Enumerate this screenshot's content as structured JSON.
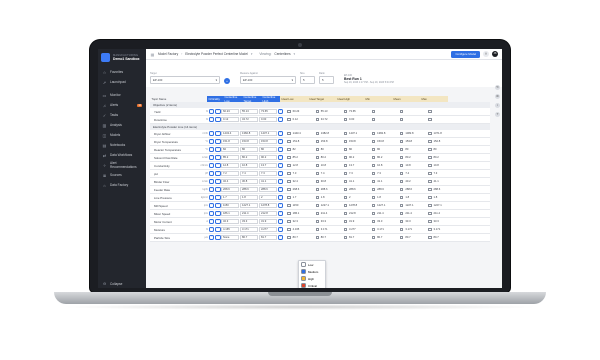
{
  "sidebar": {
    "org": "MANUFACTURING",
    "workspace": "Demo1 Sandbox",
    "items": [
      {
        "label": "Favorites",
        "icon": "star-icon"
      },
      {
        "label": "Launchpad",
        "icon": "rocket-icon"
      },
      {
        "label": "Monitor",
        "icon": "monitor-icon"
      },
      {
        "label": "Alerts",
        "icon": "bell-icon",
        "badge": "12"
      },
      {
        "label": "Tasks",
        "icon": "check-icon"
      },
      {
        "label": "Analysis",
        "icon": "chart-icon"
      },
      {
        "label": "Models",
        "icon": "cube-icon"
      },
      {
        "label": "Notebooks",
        "icon": "book-icon"
      },
      {
        "label": "Data Workflows",
        "icon": "flow-icon"
      },
      {
        "label": "Alert Recommendations",
        "icon": "lightbulb-icon"
      },
      {
        "label": "Sources",
        "icon": "database-icon"
      },
      {
        "label": "Data Factory",
        "icon": "factory-icon"
      }
    ],
    "collapse_label": "Collapse"
  },
  "topbar": {
    "breadcrumb": [
      "Model Factory",
      "Electrolyte Powder Perfect Centerline Model"
    ],
    "viewing_label": "Viewing:",
    "view_value": "Centerlines",
    "config_button": "Configure Model",
    "avatar": "JS"
  },
  "controls": {
    "target_label": "Target",
    "target_value": "EP-100",
    "measure_label": "Measure Against",
    "measure_value": "EP-100",
    "size_label": "Size",
    "size_value": "5",
    "rank_label": "Rank",
    "rank_value": "5",
    "batch_label": "EP-100",
    "batch_title": "Best Run 1",
    "batch_date": "Sep 19, 2023 1:17 PM - Sep 19, 2023 5:04 PM"
  },
  "table": {
    "col_topic": "Topic Name",
    "col_criticality": "Criticality",
    "col_low": "Centerline Low",
    "col_target": "Centerline Target",
    "col_high": "Centerline High",
    "col_ideal_low": "Ideal Low",
    "col_ideal_target": "Ideal Target",
    "col_ideal_high": "Ideal High",
    "col_min": "Min",
    "col_mean": "Mean",
    "col_max": "Max",
    "objective_section": "Objective (2 items)",
    "parameter_section": "Electrolyte Powder Line (14 items)",
    "objective_rows": [
      {
        "name": "Yield",
        "unit": "%",
        "low": "60.23",
        "target": "55.13",
        "high": "73.65",
        "ideal": "60.23",
        "mid": "55.13",
        "hi": "73.65",
        "min": "",
        "mean": "",
        "max": ""
      },
      {
        "name": "Downtime",
        "unit": "%",
        "low": "0.12",
        "target": "34.72",
        "high": "0.00",
        "ideal": "0.12",
        "mid": "34.72",
        "hi": "0.00",
        "min": "",
        "mean": "",
        "max": ""
      }
    ],
    "rows": [
      {
        "name": "Dryer Airflow",
        "unit": "m³/hr",
        "low": "1443.4",
        "target": "1382.8",
        "high": "1437.1",
        "ideal": "1443.4",
        "mid": "1382.8",
        "hi": "1437.1",
        "min": "1382.8",
        "mean": "1382.8",
        "max": "1371.8"
      },
      {
        "name": "Dryer Temperature",
        "unit": "°C",
        "low": "151.8",
        "target": "153.8",
        "high": "153.8",
        "ideal": "151.8",
        "mid": "153.8",
        "hi": "153.8",
        "min": "153.8",
        "mean": "153.8",
        "max": "152.8"
      },
      {
        "name": "Reactor Temperature",
        "unit": "°C",
        "low": "82",
        "target": "80",
        "high": "80",
        "ideal": "82",
        "mid": "80",
        "hi": "80",
        "min": "80",
        "mean": "80",
        "max": "80"
      },
      {
        "name": "Solvent Flow Rate",
        "unit": "L/min",
        "low": "85.2",
        "target": "80.2",
        "high": "90.2",
        "ideal": "85.2",
        "mid": "80.2",
        "hi": "90.2",
        "min": "80.2",
        "mean": "80.2",
        "max": "80.2"
      },
      {
        "name": "Conductivity",
        "unit": "mS/cm",
        "low": "12.8",
        "target": "10.8",
        "high": "13.7",
        "ideal": "12.8",
        "mid": "10.8",
        "hi": "13.7",
        "min": "10.8",
        "mean": "10.8",
        "max": "10.8"
      },
      {
        "name": "pH",
        "unit": "pH",
        "low": "7.2",
        "target": "7.4",
        "high": "7.3",
        "ideal": "7.3",
        "mid": "7.4",
        "hi": "7.3",
        "min": "7.3",
        "mean": "7.4",
        "max": "7.3"
      },
      {
        "name": "Binder Flow",
        "unit": "L/min",
        "low": "32.4",
        "target": "30.8",
        "high": "41.1",
        "ideal": "32.4",
        "mid": "30.8",
        "hi": "41.1",
        "min": "41.1",
        "mean": "40.2",
        "max": "41.1"
      },
      {
        "name": "Feeder Rate",
        "unit": "kg/hr",
        "low": "268.6",
        "target": "288.6",
        "high": "288.6",
        "ideal": "268.6",
        "mid": "288.6",
        "hi": "288.6",
        "min": "288.6",
        "mean": "288.6",
        "max": "288.6"
      },
      {
        "name": "Line Pressure",
        "unit": "kg/cm²",
        "low": "1.7",
        "target": "1.8",
        "high": "2",
        "ideal": "1.7",
        "mid": "1.8",
        "hi": "2",
        "min": "1.8",
        "mean": "1.8",
        "max": "1.8"
      },
      {
        "name": "Mill Speed",
        "unit": "rpm",
        "low": "1150",
        "target": "1227.1",
        "high": "1278.8",
        "ideal": "1150",
        "mid": "1227.1",
        "hi": "1278.8",
        "min": "1227.1",
        "mean": "1227.1",
        "max": "1227.1"
      },
      {
        "name": "Mixer Speed",
        "unit": "rpm",
        "low": "186.1",
        "target": "211.4",
        "high": "212.8",
        "ideal": "186.1",
        "mid": "211.4",
        "hi": "212.8",
        "min": "211.4",
        "mean": "211.4",
        "max": "211.4"
      },
      {
        "name": "Motor Current",
        "unit": "A",
        "low": "32.3",
        "target": "33.3",
        "high": "31.9",
        "ideal": "32.3",
        "mid": "33.3",
        "hi": "31.9",
        "min": "33.3",
        "mean": "33.3",
        "max": "33.3"
      },
      {
        "name": "Moisture",
        "unit": "%",
        "low": "4.165",
        "target": "3.171",
        "high": "3.277",
        "ideal": "4.165",
        "mid": "3.171",
        "hi": "3.277",
        "min": "3.171",
        "mean": "3.171",
        "max": "3.171"
      },
      {
        "name": "Particle Size",
        "unit": "µm",
        "low": "None",
        "target": "80.7",
        "high": "81.7",
        "ideal": "80.7",
        "mid": "80.7",
        "hi": "81.7",
        "min": "80.7",
        "mean": "80.7",
        "max": "80.7"
      }
    ]
  },
  "criticality_menu": {
    "options": [
      {
        "label": "Low",
        "color": "#ffffff"
      },
      {
        "label": "Medium",
        "color": "#2f6fe4"
      },
      {
        "label": "High",
        "color": "#f2b632"
      },
      {
        "label": "Critical",
        "color": "#e0452c"
      }
    ]
  }
}
